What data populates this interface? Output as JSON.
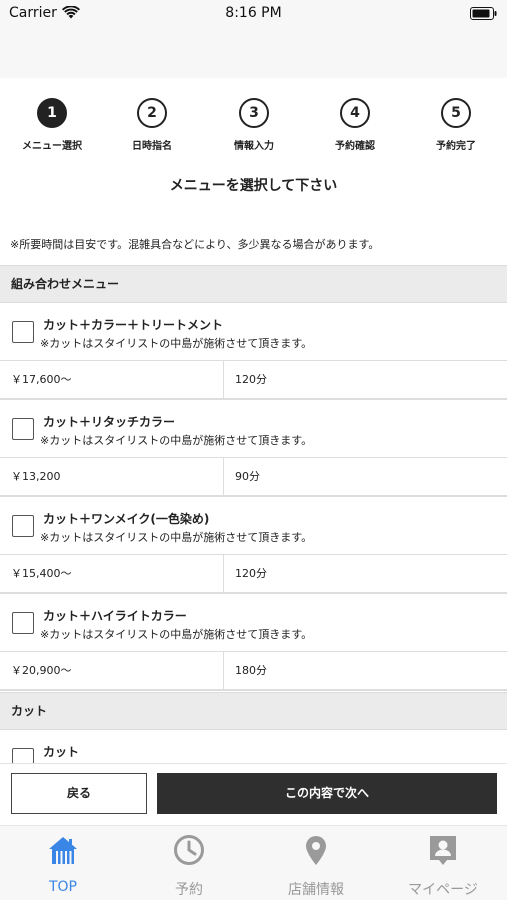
{
  "status_bar": {
    "carrier": "Carrier",
    "time": "8:16 PM"
  },
  "steps": [
    {
      "number": "1",
      "label": "メニュー選択",
      "active": true
    },
    {
      "number": "2",
      "label": "日時指名",
      "active": false
    },
    {
      "number": "3",
      "label": "情報入力",
      "active": false
    },
    {
      "number": "4",
      "label": "予約確認",
      "active": false
    },
    {
      "number": "5",
      "label": "予約完了",
      "active": false
    }
  ],
  "heading": "メニューを選択して下さい",
  "notice": "※所要時間は目安です。混雑具合などにより、多少異なる場合があります。",
  "sections": {
    "combo": {
      "title": "組み合わせメニュー"
    },
    "cut": {
      "title": "カット"
    }
  },
  "menu_items": [
    {
      "name": "カット＋カラー＋トリートメント",
      "note": "※カットはスタイリストの中島が施術させて頂きます。",
      "price": "￥17,600〜",
      "duration": "120分",
      "checked": false
    },
    {
      "name": "カット＋リタッチカラー",
      "note": "※カットはスタイリストの中島が施術させて頂きます。",
      "price": "￥13,200",
      "duration": "90分",
      "checked": false
    },
    {
      "name": "カット＋ワンメイク(一色染め)",
      "note": "※カットはスタイリストの中島が施術させて頂きます。",
      "price": "￥15,400〜",
      "duration": "120分",
      "checked": false
    },
    {
      "name": "カット＋ハイライトカラー",
      "note": "※カットはスタイリストの中島が施術させて頂きます。",
      "price": "￥20,900〜",
      "duration": "180分",
      "checked": false
    }
  ],
  "cut_items": [
    {
      "name": "カット",
      "checked": false
    }
  ],
  "buttons": {
    "back": "戻る",
    "next": "この内容で次へ"
  },
  "tab_bar": {
    "items": [
      {
        "label": "TOP",
        "icon": "home-icon",
        "active": true
      },
      {
        "label": "予約",
        "icon": "clock-icon",
        "active": false
      },
      {
        "label": "店舗情報",
        "icon": "map-pin-icon",
        "active": false
      },
      {
        "label": "マイページ",
        "icon": "profile-icon",
        "active": false
      }
    ],
    "active_color": "#3a86e6",
    "inactive_color": "#999999"
  }
}
